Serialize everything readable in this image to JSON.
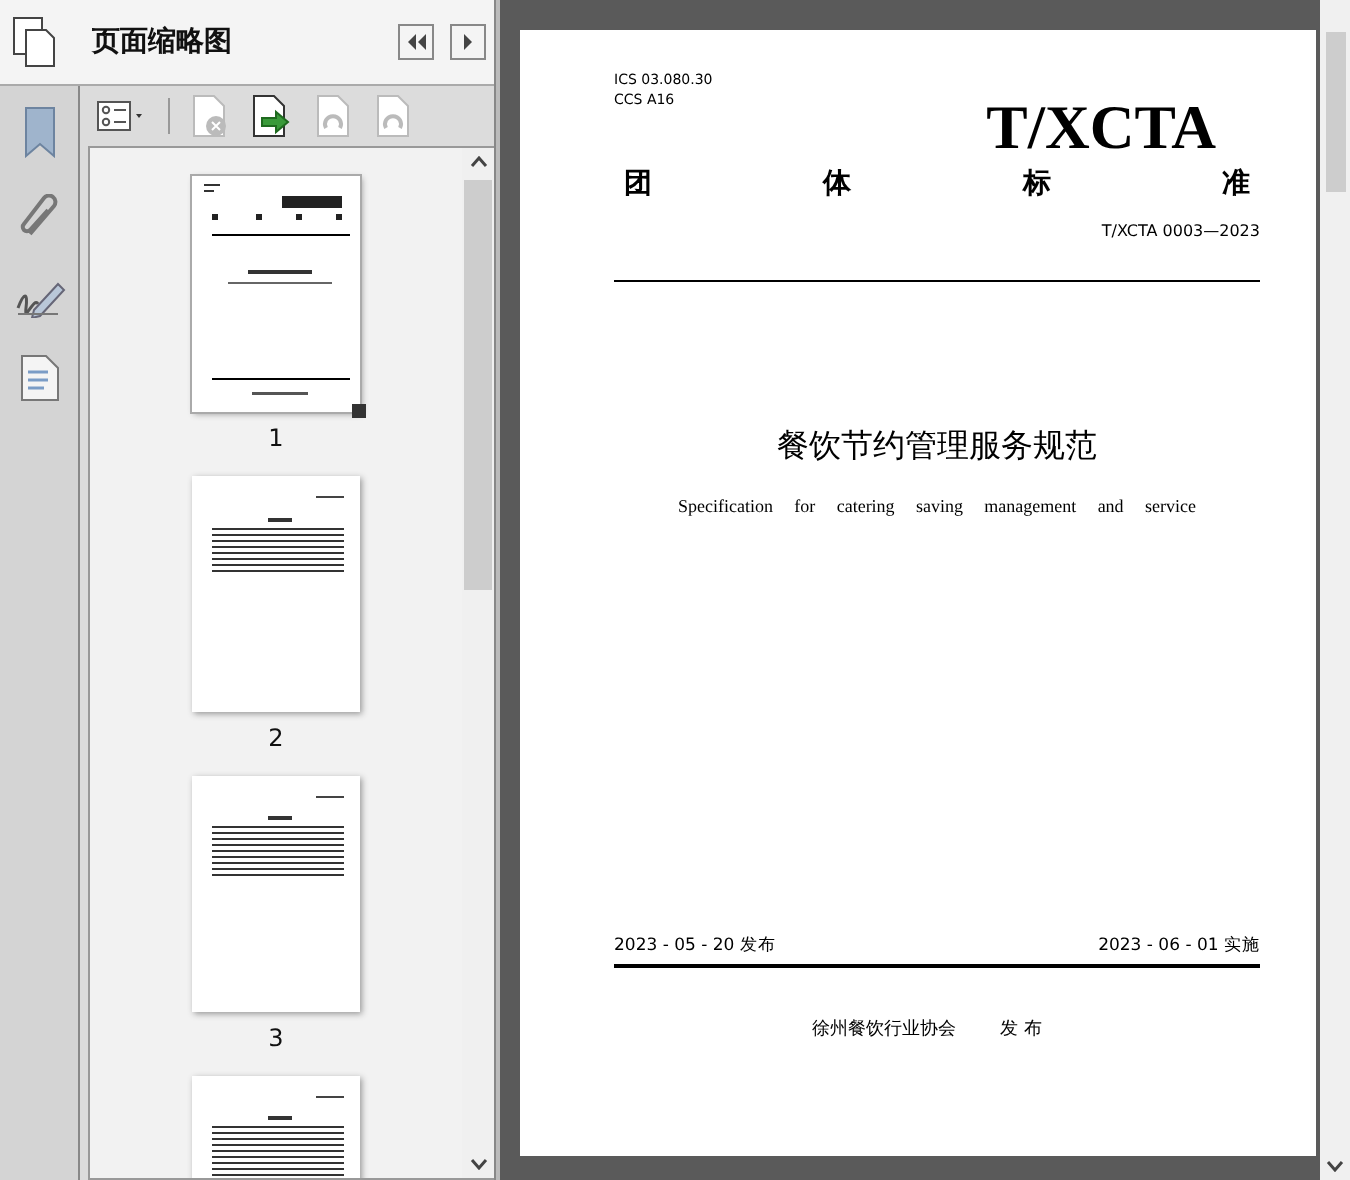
{
  "panel": {
    "title": "页面缩略图"
  },
  "toolbar": [
    {
      "kind": "options",
      "disabled": false
    },
    {
      "kind": "delete",
      "disabled": true
    },
    {
      "kind": "insert",
      "disabled": false
    },
    {
      "kind": "rotate",
      "disabled": true
    },
    {
      "kind": "rotate",
      "disabled": true
    }
  ],
  "thumbnails": [
    {
      "kind": "cover",
      "label": "1",
      "selected": true
    },
    {
      "kind": "contents",
      "label": "2",
      "selected": false
    },
    {
      "kind": "text",
      "label": "3",
      "selected": false
    },
    {
      "kind": "text",
      "selected": false
    }
  ],
  "document": {
    "ics": "ICS  03.080.30",
    "ccs": "CCS  A16",
    "logo": "T/XCTA",
    "category": [
      "团",
      "体",
      "标",
      "准"
    ],
    "code": "T/XCTA 0003—2023",
    "title": "餐饮节约管理服务规范",
    "subtitle": [
      "Specification",
      "for",
      "catering",
      "saving",
      "management",
      "and",
      "service"
    ],
    "issued": "2023 - 05 - 20 发布",
    "effective": "2023 - 06 - 01 实施",
    "publisher": "徐州餐饮行业协会",
    "publish_word": "发 布"
  }
}
